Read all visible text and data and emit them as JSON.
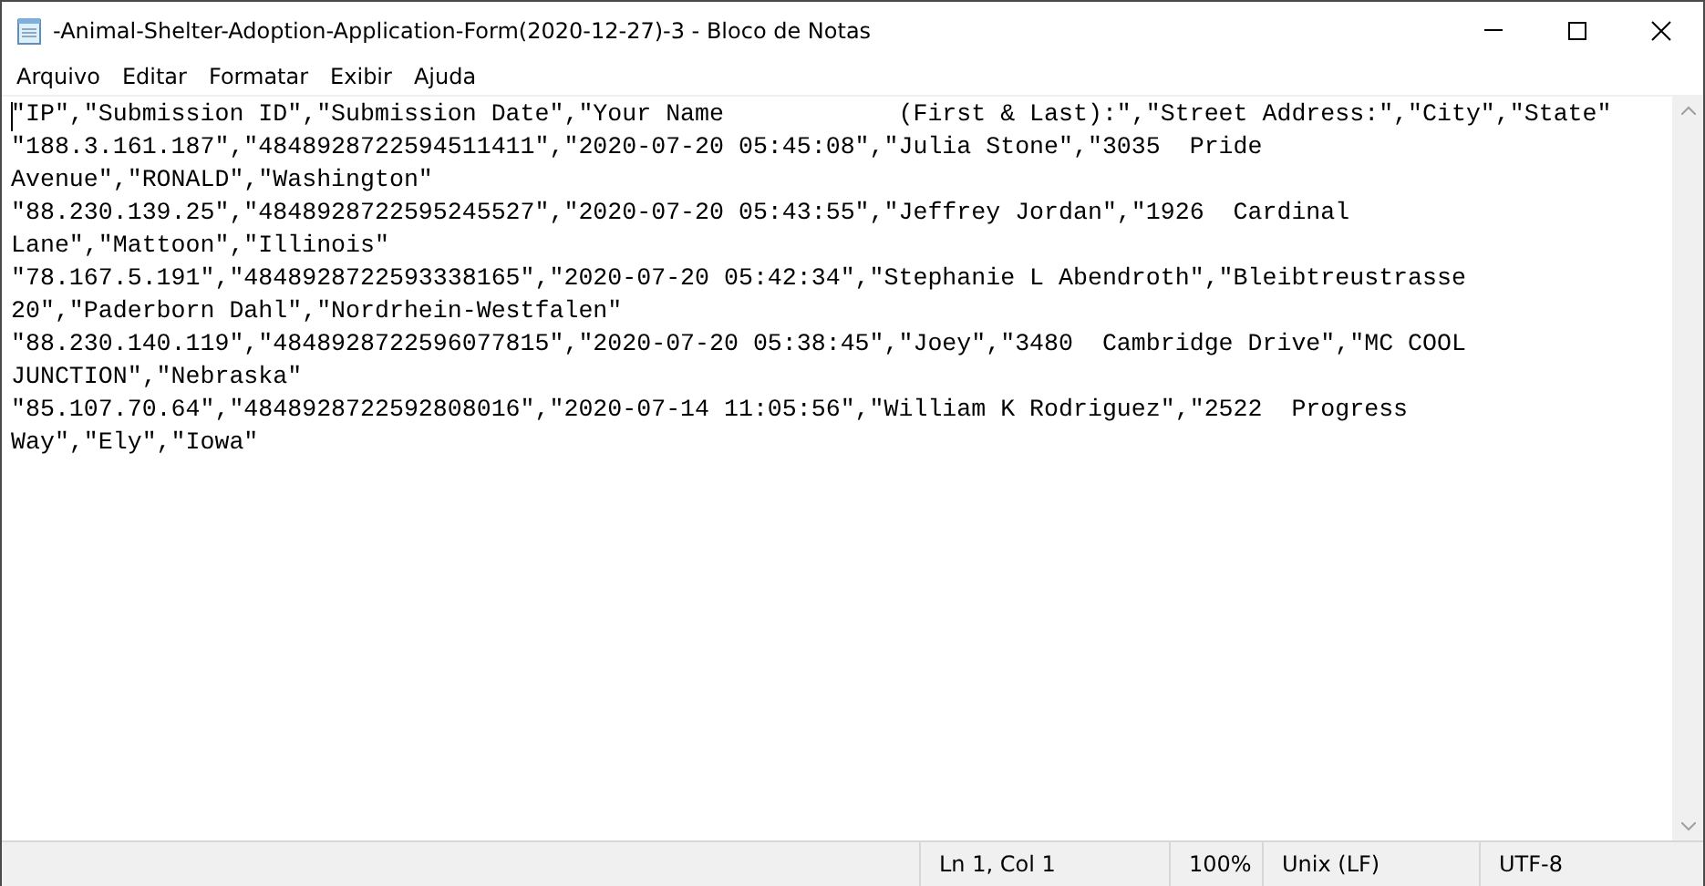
{
  "window": {
    "title": "-Animal-Shelter-Adoption-Application-Form(2020-12-27)-3 - Bloco de Notas"
  },
  "menu": [
    "Arquivo",
    "Editar",
    "Formatar",
    "Exibir",
    "Ajuda"
  ],
  "editor": {
    "lines": [
      "\"IP\",\"Submission ID\",\"Submission Date\",\"Your Name            (First & Last):\",\"Street Address:\",\"City\",\"State\"",
      "\"188.3.161.187\",\"4848928722594511411\",\"2020-07-20 05:45:08\",\"Julia Stone\",\"3035  Pride",
      "Avenue\",\"RONALD\",\"Washington\"",
      "\"88.230.139.25\",\"4848928722595245527\",\"2020-07-20 05:43:55\",\"Jeffrey Jordan\",\"1926  Cardinal",
      "Lane\",\"Mattoon\",\"Illinois\"",
      "\"78.167.5.191\",\"4848928722593338165\",\"2020-07-20 05:42:34\",\"Stephanie L Abendroth\",\"Bleibtreustrasse",
      "20\",\"Paderborn Dahl\",\"Nordrhein-Westfalen\"",
      "\"88.230.140.119\",\"4848928722596077815\",\"2020-07-20 05:38:45\",\"Joey\",\"3480  Cambridge Drive\",\"MC COOL",
      "JUNCTION\",\"Nebraska\"",
      "\"85.107.70.64\",\"4848928722592808016\",\"2020-07-14 11:05:56\",\"William K Rodriguez\",\"2522  Progress",
      "Way\",\"Ely\",\"Iowa\""
    ]
  },
  "status_bar": {
    "position": "Ln 1, Col 1",
    "zoom": "100%",
    "line_ending": "Unix (LF)",
    "encoding": "UTF-8"
  }
}
